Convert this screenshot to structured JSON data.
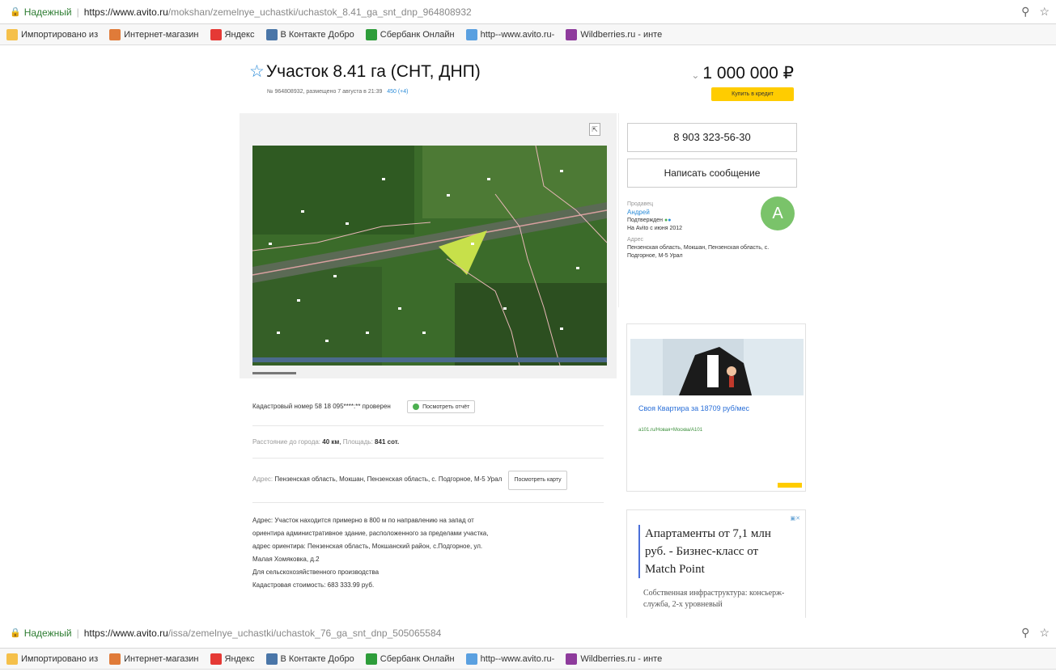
{
  "browser_top": {
    "secure_label": "Надежный",
    "url_host": "https://www.avito.ru",
    "url_path": "/mokshan/zemelnye_uchastki/uchastok_8.41_ga_snt_dnp_964808932"
  },
  "browser_bottom": {
    "secure_label": "Надежный",
    "url_host": "https://www.avito.ru",
    "url_path": "/issa/zemelnye_uchastki/uchastok_76_ga_snt_dnp_505065584"
  },
  "bookmarks": [
    {
      "label": "Импортировано из",
      "color": "#f5c04a"
    },
    {
      "label": "Интернет-магазин",
      "color": "#e07b39"
    },
    {
      "label": "Яндекс",
      "color": "#e53935"
    },
    {
      "label": "В Контакте  Добро",
      "color": "#4a76a8"
    },
    {
      "label": "Сбербанк Онлайн",
      "color": "#2e9d3a"
    },
    {
      "label": "http--www.avito.ru-",
      "color": "#5aa0e0"
    },
    {
      "label": "Wildberries.ru - инте",
      "color": "#8e3b9c"
    }
  ],
  "listing": {
    "title": "Участок 8.41 га (СНТ, ДНП)",
    "subtitle": "№ 964808932, размещено 7 августа в 21:39",
    "views": "450 (+4)",
    "price": "1 000 000 ₽",
    "credit_button": "Купить в кредит"
  },
  "contact": {
    "phone": "8 903 323-56-30",
    "message_button": "Написать сообщение",
    "seller_label": "Продавец",
    "seller_name": "Андрей",
    "seller_status": "Подтвержден",
    "seller_since": "На Avito с июня 2012",
    "address_label": "Адрес",
    "address": "Пензенская область, Мокшан, Пензенская область, с. Подгорное, М-5 Урал",
    "avatar_letter": "А"
  },
  "info": {
    "cadastral": "Кадастровый номер 58 18 095****:** проверен",
    "report_button": "Посмотреть отчёт",
    "distance_label": "Расстояние до города:",
    "distance_value": "40 км",
    "area_label": "Площадь:",
    "area_value": "841 сот.",
    "address_label": "Адрес:",
    "address_value": "Пензенская область, Мокшан, Пензенская область, с. Подгорное, М-5 Урал",
    "map_button": "Посмотреть карту"
  },
  "description": [
    "Адрес: Участок находится примерно в 800 м по направлению на запад от",
    "ориентира административное здание, расположенного за пределами участка,",
    "адрес ориентира: Пензенская область, Мокшанский район, с.Подгорное, ул.",
    "Малая Хомяковка, д.2",
    "Для сельскохозяйственного производства",
    "Кадастровая стоимость: 683 333.99 руб."
  ],
  "ad1": {
    "title": "Своя Квартира за 18709 руб/мес",
    "url": "a101.ru/Новая+Москва/A101"
  },
  "ad2": {
    "title": "Апартаменты от 7,1 млн руб. - Бизнес-класс от Match Point",
    "body": "Собственная инфраструктура: консьерж-служба, 2-х уровневый"
  }
}
